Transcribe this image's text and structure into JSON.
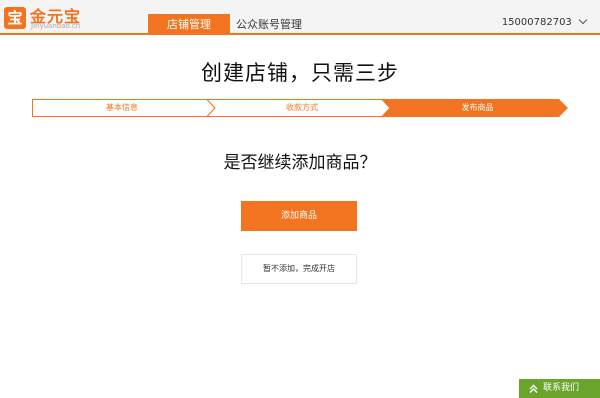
{
  "header": {
    "logo_mark": "宝",
    "logo_name": "金元宝",
    "logo_domain": "Jinyuanbao.cn",
    "tabs": [
      {
        "label": "店铺管理",
        "active": true
      },
      {
        "label": "公众账号管理",
        "active": false
      }
    ],
    "user": "15000782703"
  },
  "main": {
    "title": "创建店铺，只需三步",
    "steps": [
      {
        "label": "基本信息",
        "state": "done"
      },
      {
        "label": "收款方式",
        "state": "done"
      },
      {
        "label": "发布商品",
        "state": "current"
      }
    ],
    "question": "是否继续添加商品？",
    "add_button": "添加商品",
    "skip_button": "暂不添加，完成开店"
  },
  "contact": {
    "label": "联系我们"
  },
  "colors": {
    "accent": "#f37420",
    "contact_bg": "#6aa42a",
    "header_bg": "#f4f4f4"
  },
  "icons": {
    "user_menu": "chevron-down-icon",
    "contact": "chevron-up-icon"
  }
}
